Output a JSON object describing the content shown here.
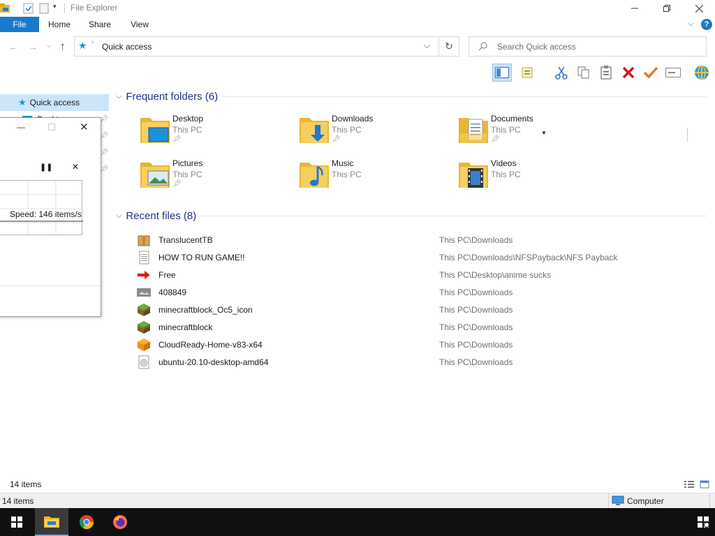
{
  "window": {
    "title": "File Explorer"
  },
  "ribbon": {
    "tabs": [
      {
        "label": "File"
      },
      {
        "label": "Home"
      },
      {
        "label": "Share"
      },
      {
        "label": "View"
      }
    ]
  },
  "address": {
    "location": "Quick access",
    "search_placeholder": "Search Quick access"
  },
  "nav": {
    "items": [
      {
        "label": "Quick access",
        "icon": "star-icon"
      },
      {
        "label": "Deskt",
        "icon": "desktop-icon"
      }
    ]
  },
  "dialog": {
    "speed_text": "Speed: 146 items/s"
  },
  "frequent": {
    "heading": "Frequent folders (6)",
    "folders": [
      {
        "name": "Desktop",
        "location": "This PC",
        "icon": "desktop-folder-icon",
        "pinned": true
      },
      {
        "name": "Downloads",
        "location": "This PC",
        "icon": "downloads-folder-icon",
        "pinned": true
      },
      {
        "name": "Documents",
        "location": "This PC",
        "icon": "documents-folder-icon",
        "pinned": true
      },
      {
        "name": "Pictures",
        "location": "This PC",
        "icon": "pictures-folder-icon",
        "pinned": true
      },
      {
        "name": "Music",
        "location": "This PC",
        "icon": "music-folder-icon",
        "pinned": false
      },
      {
        "name": "Videos",
        "location": "This PC",
        "icon": "videos-folder-icon",
        "pinned": false
      }
    ]
  },
  "recent": {
    "heading": "Recent files (8)",
    "files": [
      {
        "name": "TranslucentTB",
        "path": "This PC\\Downloads",
        "icon": "package-icon"
      },
      {
        "name": "HOW TO RUN GAME!!",
        "path": "This PC\\Downloads\\NFSPayback\\NFS Payback",
        "icon": "text-file-icon"
      },
      {
        "name": "Free",
        "path": "This PC\\Desktop\\anime sucks",
        "icon": "red-arrow-icon"
      },
      {
        "name": "408849",
        "path": "This PC\\Downloads",
        "icon": "image-file-icon"
      },
      {
        "name": "minecraftblock_Oc5_icon",
        "path": "This PC\\Downloads",
        "icon": "grass-block-icon"
      },
      {
        "name": "minecraftblock",
        "path": "This PC\\Downloads",
        "icon": "grass-block-icon"
      },
      {
        "name": "CloudReady-Home-v83-x64",
        "path": "This PC\\Downloads",
        "icon": "orange-cube-icon"
      },
      {
        "name": "ubuntu-20.10-desktop-amd64",
        "path": "This PC\\Downloads",
        "icon": "disc-image-icon"
      }
    ]
  },
  "status": {
    "item_count": "14 items",
    "bottom_count": "14 items",
    "computer_label": "Computer"
  },
  "colors": {
    "accent": "#1979ca",
    "heading": "#1e3287",
    "selection": "#cce4f7"
  }
}
